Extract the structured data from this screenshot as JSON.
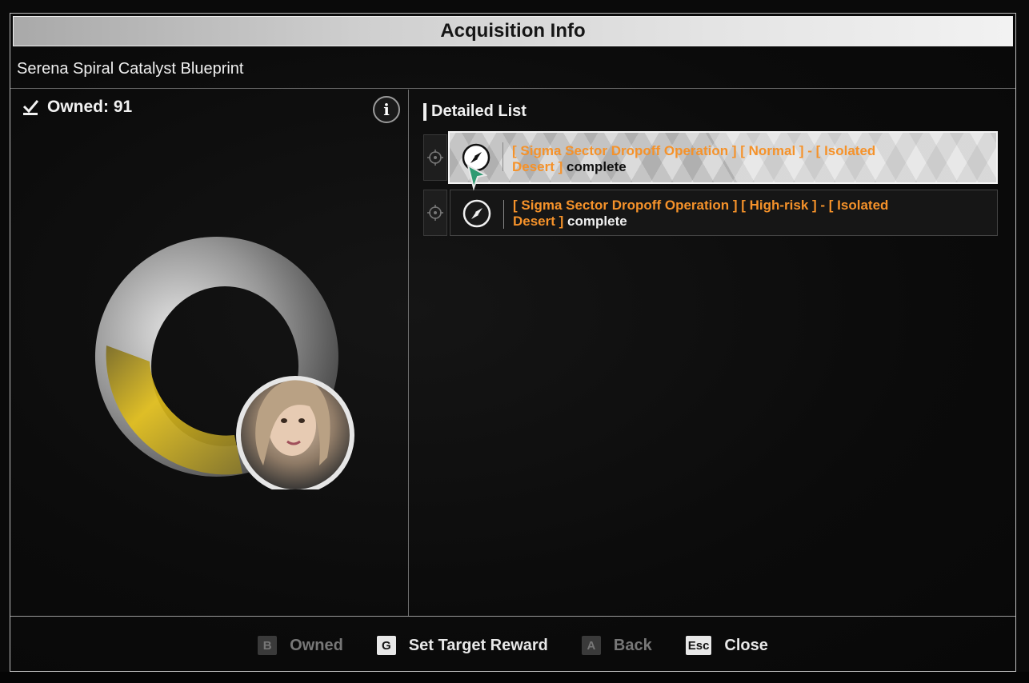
{
  "window": {
    "title": "Acquisition Info"
  },
  "item": {
    "name": "Serena Spiral Catalyst Blueprint"
  },
  "owned": {
    "label": "Owned: 91"
  },
  "detail": {
    "title": "Detailed List",
    "entries": [
      {
        "bracket_op": "[ Sigma Sector Dropoff Operation ] [ Normal ] - [ Isolated Desert ]",
        "suffix": "complete",
        "selected": true
      },
      {
        "bracket_op": "[ Sigma Sector Dropoff Operation ] [ High-risk ] - [ Isolated Desert ]",
        "suffix": "complete",
        "selected": false
      }
    ]
  },
  "footer": {
    "hints": [
      {
        "key": "B",
        "label": "Owned",
        "enabled": false
      },
      {
        "key": "G",
        "label": "Set Target Reward",
        "enabled": true
      },
      {
        "key": "A",
        "label": "Back",
        "enabled": false
      },
      {
        "key": "Esc",
        "label": "Close",
        "enabled": true
      }
    ]
  },
  "colors": {
    "accent_orange": "#f5922a",
    "title_bar": "#d9d9d9",
    "background": "#0a0a0a"
  },
  "icons": {
    "owned": "checkbox-check-icon",
    "info": "info-icon",
    "pin": "target-pin-icon",
    "entry": "compass-icon",
    "cursor": "mouse-cursor-icon"
  }
}
